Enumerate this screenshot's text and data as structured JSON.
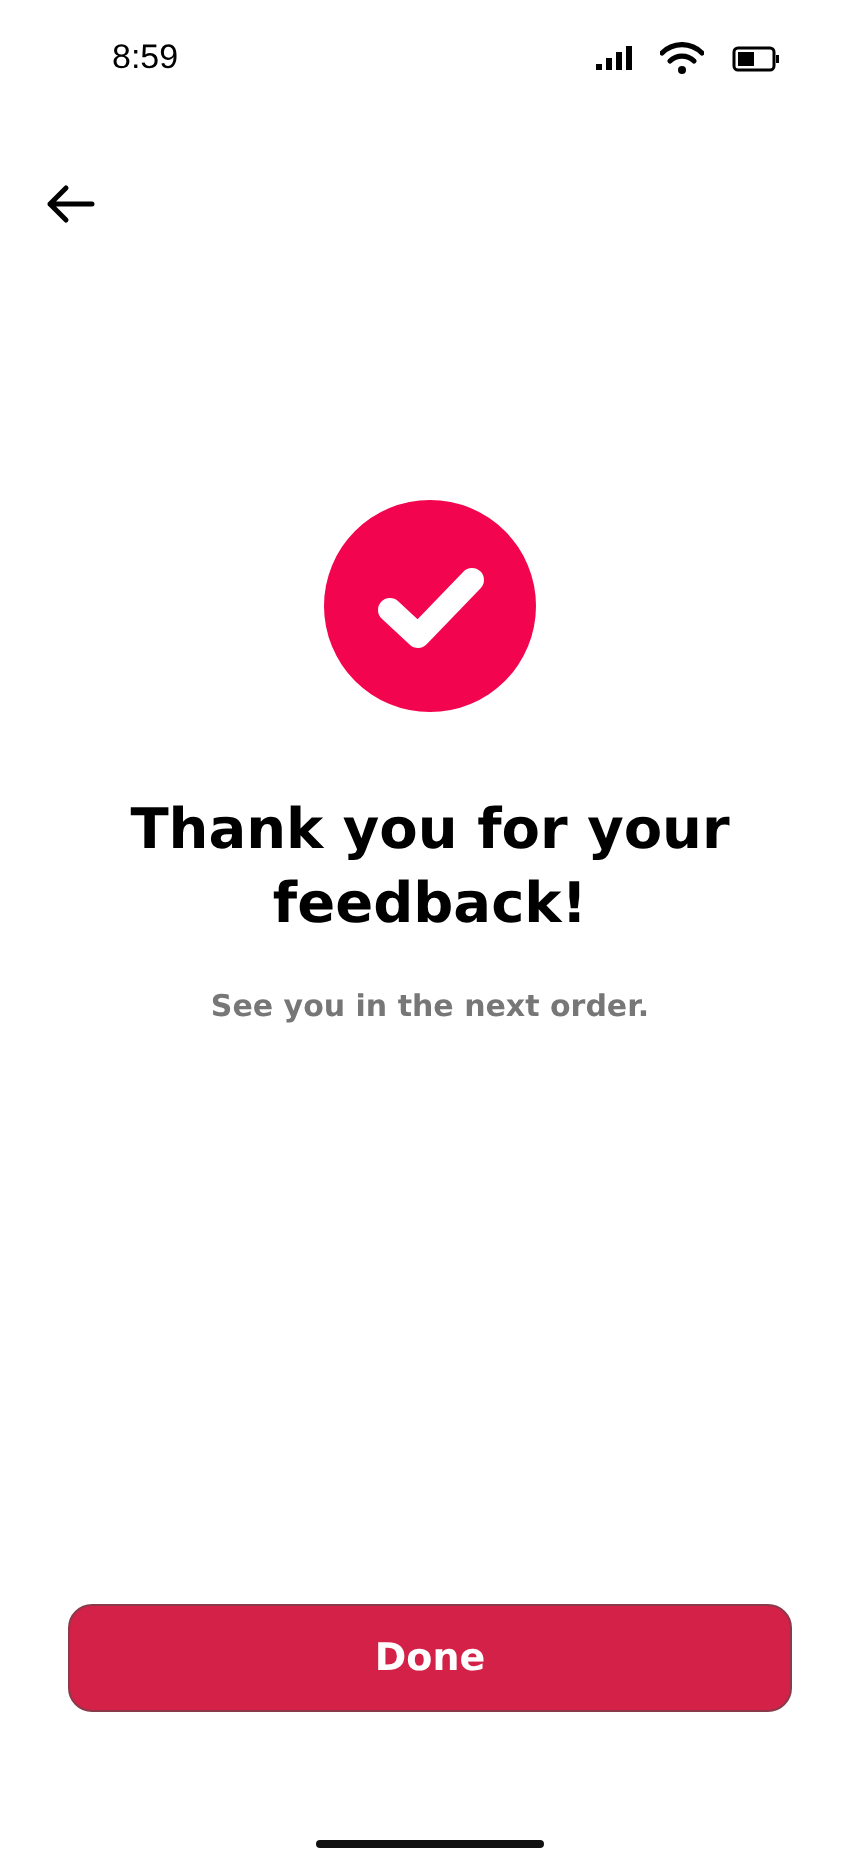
{
  "status_bar": {
    "time": "8:59"
  },
  "title": "Thank you for your feedback!",
  "subtitle": "See you in the next order.",
  "button": "Done"
}
